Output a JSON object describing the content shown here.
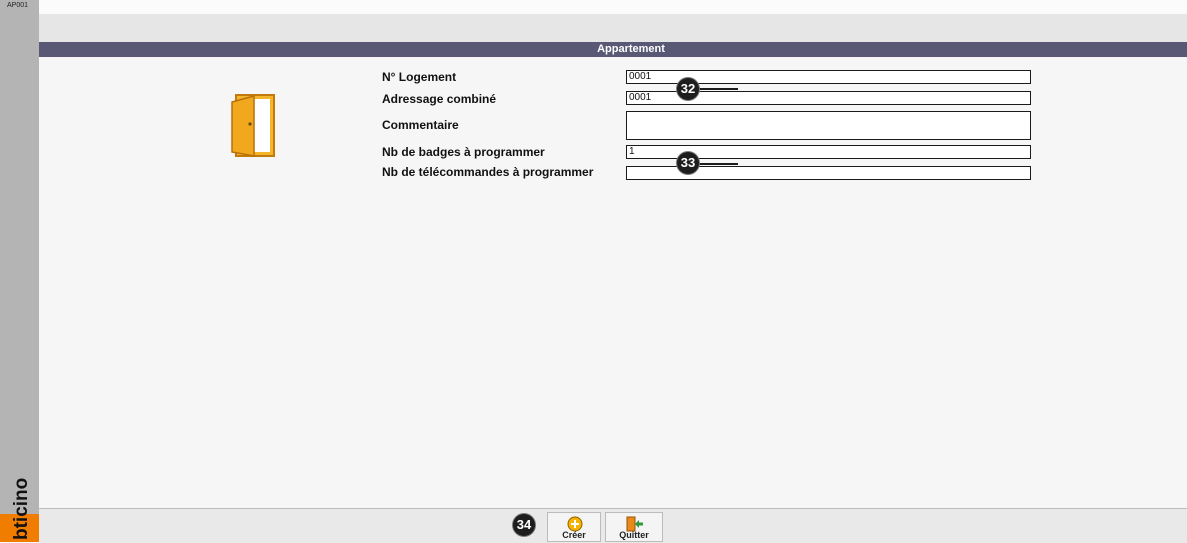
{
  "screen_code": "AP001",
  "brand": {
    "logo_text": "bticino"
  },
  "title": "Appartement",
  "form": {
    "fields": [
      {
        "label": "N° Logement",
        "value": "0001"
      },
      {
        "label": "Adressage combiné",
        "value": "0001"
      },
      {
        "label": "Commentaire",
        "value": ""
      },
      {
        "label": "Nb de badges à programmer",
        "value": "1"
      },
      {
        "label": "Nb de télécommandes à programmer",
        "value": ""
      }
    ]
  },
  "callouts": {
    "a": "32",
    "b": "33",
    "c": "34"
  },
  "toolbar": {
    "create_label": "Créer",
    "quit_label": "Quitter"
  },
  "colors": {
    "title_bar": "#595976",
    "sidebar": "#b4b4b4",
    "door": "#f2a81c",
    "logo_orange": "#f07d00"
  },
  "icons": [
    "door-icon",
    "create-icon",
    "quit-icon"
  ]
}
